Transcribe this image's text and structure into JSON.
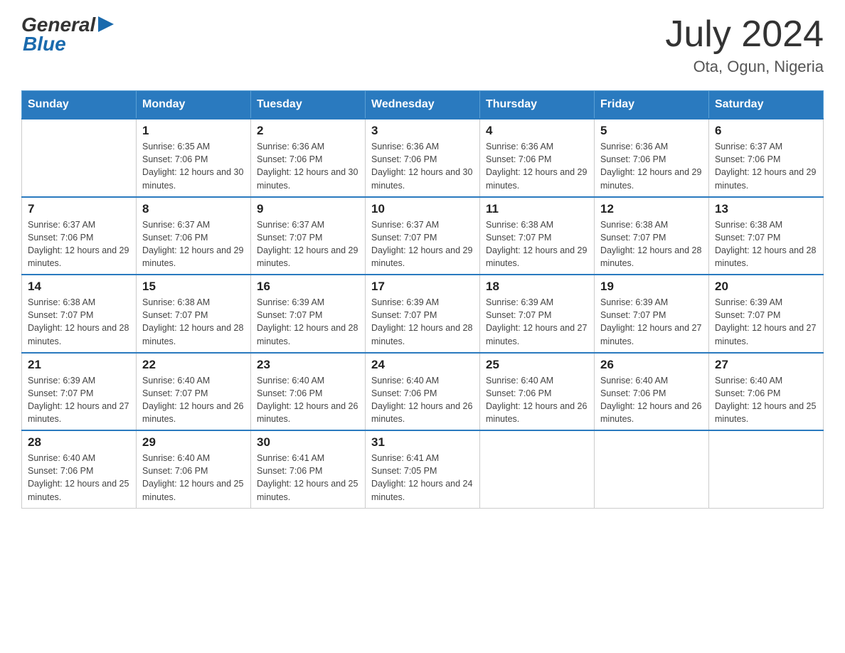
{
  "header": {
    "logo_general": "General",
    "logo_blue": "Blue",
    "month_year": "July 2024",
    "location": "Ota, Ogun, Nigeria"
  },
  "weekdays": [
    "Sunday",
    "Monday",
    "Tuesday",
    "Wednesday",
    "Thursday",
    "Friday",
    "Saturday"
  ],
  "weeks": [
    [
      {
        "day": "",
        "sunrise": "",
        "sunset": "",
        "daylight": ""
      },
      {
        "day": "1",
        "sunrise": "Sunrise: 6:35 AM",
        "sunset": "Sunset: 7:06 PM",
        "daylight": "Daylight: 12 hours and 30 minutes."
      },
      {
        "day": "2",
        "sunrise": "Sunrise: 6:36 AM",
        "sunset": "Sunset: 7:06 PM",
        "daylight": "Daylight: 12 hours and 30 minutes."
      },
      {
        "day": "3",
        "sunrise": "Sunrise: 6:36 AM",
        "sunset": "Sunset: 7:06 PM",
        "daylight": "Daylight: 12 hours and 30 minutes."
      },
      {
        "day": "4",
        "sunrise": "Sunrise: 6:36 AM",
        "sunset": "Sunset: 7:06 PM",
        "daylight": "Daylight: 12 hours and 29 minutes."
      },
      {
        "day": "5",
        "sunrise": "Sunrise: 6:36 AM",
        "sunset": "Sunset: 7:06 PM",
        "daylight": "Daylight: 12 hours and 29 minutes."
      },
      {
        "day": "6",
        "sunrise": "Sunrise: 6:37 AM",
        "sunset": "Sunset: 7:06 PM",
        "daylight": "Daylight: 12 hours and 29 minutes."
      }
    ],
    [
      {
        "day": "7",
        "sunrise": "Sunrise: 6:37 AM",
        "sunset": "Sunset: 7:06 PM",
        "daylight": "Daylight: 12 hours and 29 minutes."
      },
      {
        "day": "8",
        "sunrise": "Sunrise: 6:37 AM",
        "sunset": "Sunset: 7:06 PM",
        "daylight": "Daylight: 12 hours and 29 minutes."
      },
      {
        "day": "9",
        "sunrise": "Sunrise: 6:37 AM",
        "sunset": "Sunset: 7:07 PM",
        "daylight": "Daylight: 12 hours and 29 minutes."
      },
      {
        "day": "10",
        "sunrise": "Sunrise: 6:37 AM",
        "sunset": "Sunset: 7:07 PM",
        "daylight": "Daylight: 12 hours and 29 minutes."
      },
      {
        "day": "11",
        "sunrise": "Sunrise: 6:38 AM",
        "sunset": "Sunset: 7:07 PM",
        "daylight": "Daylight: 12 hours and 29 minutes."
      },
      {
        "day": "12",
        "sunrise": "Sunrise: 6:38 AM",
        "sunset": "Sunset: 7:07 PM",
        "daylight": "Daylight: 12 hours and 28 minutes."
      },
      {
        "day": "13",
        "sunrise": "Sunrise: 6:38 AM",
        "sunset": "Sunset: 7:07 PM",
        "daylight": "Daylight: 12 hours and 28 minutes."
      }
    ],
    [
      {
        "day": "14",
        "sunrise": "Sunrise: 6:38 AM",
        "sunset": "Sunset: 7:07 PM",
        "daylight": "Daylight: 12 hours and 28 minutes."
      },
      {
        "day": "15",
        "sunrise": "Sunrise: 6:38 AM",
        "sunset": "Sunset: 7:07 PM",
        "daylight": "Daylight: 12 hours and 28 minutes."
      },
      {
        "day": "16",
        "sunrise": "Sunrise: 6:39 AM",
        "sunset": "Sunset: 7:07 PM",
        "daylight": "Daylight: 12 hours and 28 minutes."
      },
      {
        "day": "17",
        "sunrise": "Sunrise: 6:39 AM",
        "sunset": "Sunset: 7:07 PM",
        "daylight": "Daylight: 12 hours and 28 minutes."
      },
      {
        "day": "18",
        "sunrise": "Sunrise: 6:39 AM",
        "sunset": "Sunset: 7:07 PM",
        "daylight": "Daylight: 12 hours and 27 minutes."
      },
      {
        "day": "19",
        "sunrise": "Sunrise: 6:39 AM",
        "sunset": "Sunset: 7:07 PM",
        "daylight": "Daylight: 12 hours and 27 minutes."
      },
      {
        "day": "20",
        "sunrise": "Sunrise: 6:39 AM",
        "sunset": "Sunset: 7:07 PM",
        "daylight": "Daylight: 12 hours and 27 minutes."
      }
    ],
    [
      {
        "day": "21",
        "sunrise": "Sunrise: 6:39 AM",
        "sunset": "Sunset: 7:07 PM",
        "daylight": "Daylight: 12 hours and 27 minutes."
      },
      {
        "day": "22",
        "sunrise": "Sunrise: 6:40 AM",
        "sunset": "Sunset: 7:07 PM",
        "daylight": "Daylight: 12 hours and 26 minutes."
      },
      {
        "day": "23",
        "sunrise": "Sunrise: 6:40 AM",
        "sunset": "Sunset: 7:06 PM",
        "daylight": "Daylight: 12 hours and 26 minutes."
      },
      {
        "day": "24",
        "sunrise": "Sunrise: 6:40 AM",
        "sunset": "Sunset: 7:06 PM",
        "daylight": "Daylight: 12 hours and 26 minutes."
      },
      {
        "day": "25",
        "sunrise": "Sunrise: 6:40 AM",
        "sunset": "Sunset: 7:06 PM",
        "daylight": "Daylight: 12 hours and 26 minutes."
      },
      {
        "day": "26",
        "sunrise": "Sunrise: 6:40 AM",
        "sunset": "Sunset: 7:06 PM",
        "daylight": "Daylight: 12 hours and 26 minutes."
      },
      {
        "day": "27",
        "sunrise": "Sunrise: 6:40 AM",
        "sunset": "Sunset: 7:06 PM",
        "daylight": "Daylight: 12 hours and 25 minutes."
      }
    ],
    [
      {
        "day": "28",
        "sunrise": "Sunrise: 6:40 AM",
        "sunset": "Sunset: 7:06 PM",
        "daylight": "Daylight: 12 hours and 25 minutes."
      },
      {
        "day": "29",
        "sunrise": "Sunrise: 6:40 AM",
        "sunset": "Sunset: 7:06 PM",
        "daylight": "Daylight: 12 hours and 25 minutes."
      },
      {
        "day": "30",
        "sunrise": "Sunrise: 6:41 AM",
        "sunset": "Sunset: 7:06 PM",
        "daylight": "Daylight: 12 hours and 25 minutes."
      },
      {
        "day": "31",
        "sunrise": "Sunrise: 6:41 AM",
        "sunset": "Sunset: 7:05 PM",
        "daylight": "Daylight: 12 hours and 24 minutes."
      },
      {
        "day": "",
        "sunrise": "",
        "sunset": "",
        "daylight": ""
      },
      {
        "day": "",
        "sunrise": "",
        "sunset": "",
        "daylight": ""
      },
      {
        "day": "",
        "sunrise": "",
        "sunset": "",
        "daylight": ""
      }
    ]
  ]
}
